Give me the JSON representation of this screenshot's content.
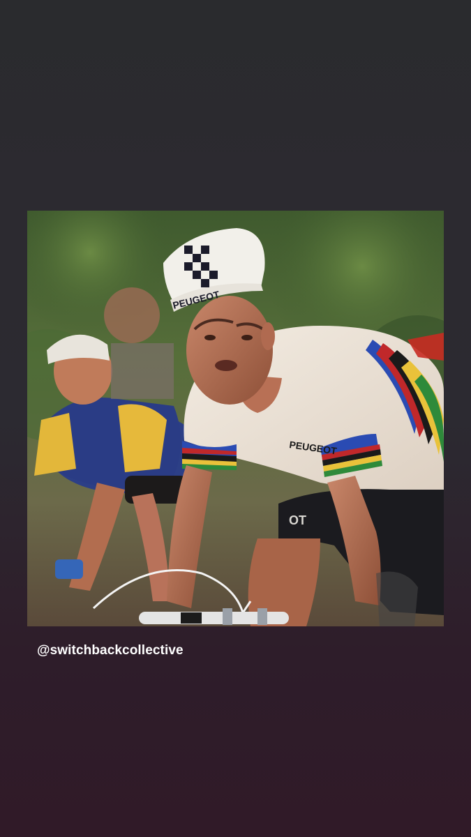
{
  "story": {
    "background_top": "#2a2b2e",
    "background_bottom": "#301a28",
    "photo": {
      "subject": "vintage cycling photograph, rider in rainbow-striped world champion jersey with checkered cap",
      "cap_text": "PEUGEOT",
      "jersey_text": "PEUGEOT"
    },
    "mention": {
      "handle": "@switchbackcollective",
      "color": "#ffffff"
    }
  }
}
